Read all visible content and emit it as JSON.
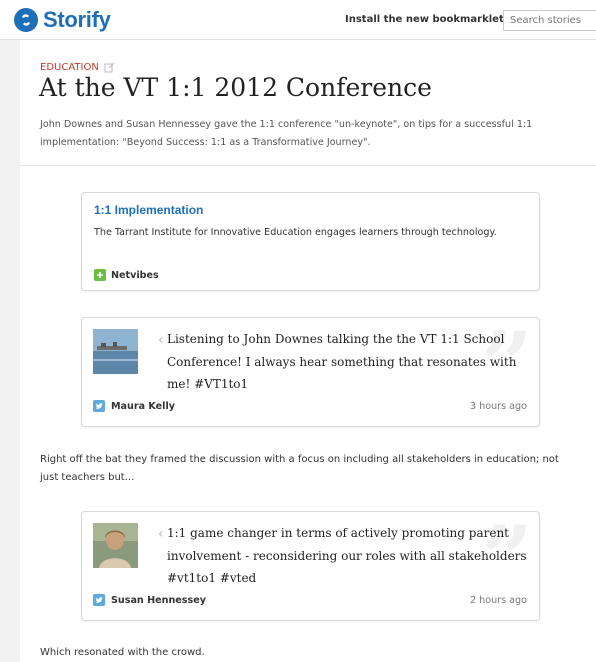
{
  "header": {
    "logo_text": "Storify",
    "bookmarklet_label": "Install the new bookmarklet!",
    "search_placeholder": "Search stories"
  },
  "story": {
    "category": "EDUCATION",
    "title": "At the VT 1:1 2012 Conference",
    "description": "John Downes and Susan Hennessey gave the 1:1 conference \"un-keynote\", on tips for a successful 1:1 implementation: \"Beyond Success: 1:1 as a Transformative Journey\"."
  },
  "link_card": {
    "title": "1:1 Implementation",
    "description": "The Tarrant Institute for Innovative Education engages learners through technology.",
    "source": "Netvibes",
    "source_icon": "plus-icon"
  },
  "tweets": [
    {
      "text": "Listening to John Downes talking the the VT 1:1 School Conference! I always hear something that resonates with me! #VT1to1",
      "author": "Maura Kelly",
      "time": "3 hours ago"
    },
    {
      "text": "1:1 game changer in terms of actively promoting parent involvement - reconsidering our roles with all stakeholders #vt1to1 #vted",
      "author": "Susan Hennessey",
      "time": "2 hours ago"
    }
  ],
  "text_blocks": [
    "Right off the bat they framed the discussion with a focus on including all stakeholders in education; not just teachers but...",
    "Which resonated with the crowd."
  ],
  "colors": {
    "brand": "#1d6fb8",
    "category": "#c0392b",
    "twitter": "#5ea9dd",
    "netvibes": "#6cbe45"
  }
}
